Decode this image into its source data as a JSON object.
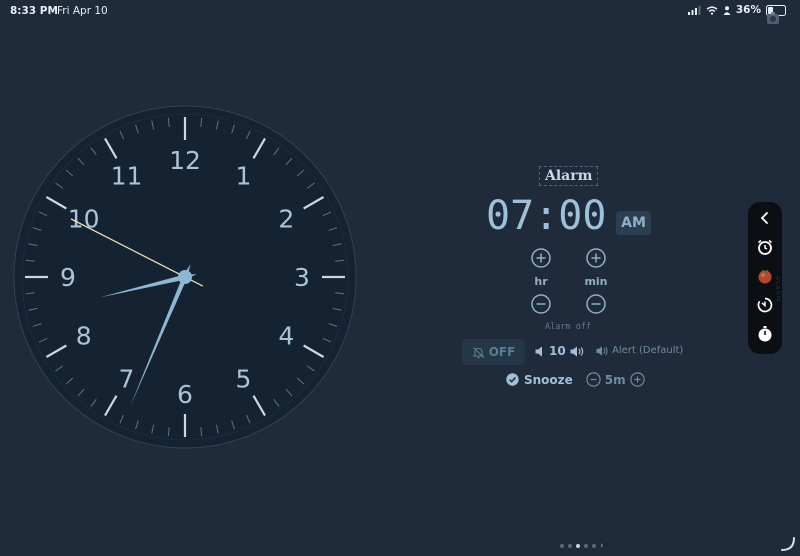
{
  "status_bar": {
    "time": "8:33 PM",
    "date": "Fri Apr 10",
    "battery": "36%",
    "battery_level": 0.36
  },
  "clock": {
    "numerals": [
      "12",
      "1",
      "2",
      "3",
      "4",
      "5",
      "6",
      "7",
      "8",
      "9",
      "10",
      "11"
    ],
    "hour": 8,
    "minute": 33,
    "second": 49.5,
    "colors": {
      "face": "#142231",
      "hands": "#8cb8d4",
      "second_hand": "#e9dfb4",
      "numerals": "#a9c4d8"
    }
  },
  "alarm": {
    "title": "Alarm",
    "time": "07:00",
    "period": "AM",
    "hour_label": "hr",
    "minute_label": "min",
    "status": "Alarm off",
    "toggle_label": "OFF",
    "volume": "10",
    "sound": "Alert (Default)",
    "snooze_label": "Snooze",
    "snooze_time": "5m"
  },
  "side_menu": {
    "label": "ALARM",
    "items": [
      "back-icon",
      "alarm-clock-icon",
      "tomato-icon",
      "timer-icon",
      "stopwatch-icon"
    ]
  },
  "page_dots": {
    "count": 5,
    "active": 2
  },
  "colors": {
    "background": "#1f2b3a",
    "accent": "#9fc0d8",
    "menu": "#0b0f14"
  }
}
